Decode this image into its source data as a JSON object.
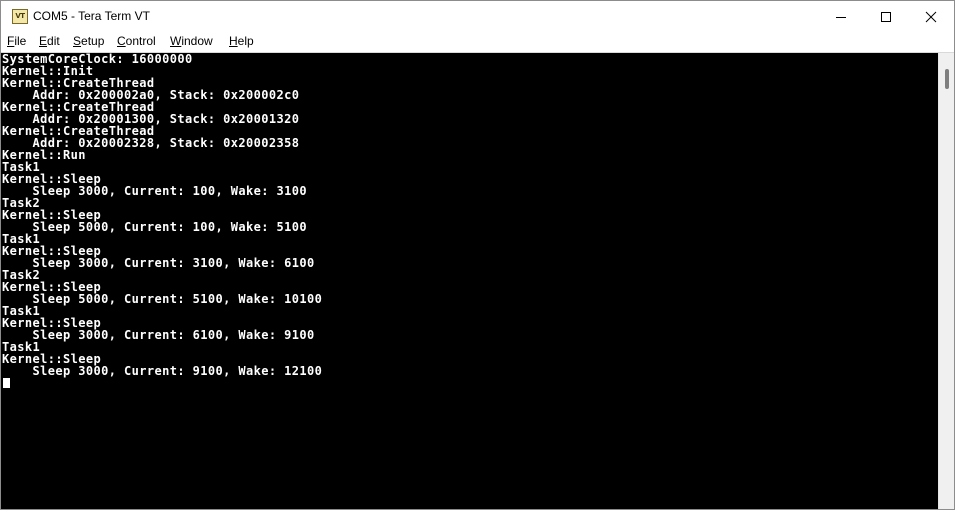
{
  "window": {
    "title": "COM5 - Tera Term VT",
    "icon_label": "VT"
  },
  "caption_buttons": {
    "minimize": "minimize-icon",
    "maximize": "maximize-icon",
    "close": "close-icon"
  },
  "menu": [
    {
      "accel": "F",
      "rest": "ile"
    },
    {
      "accel": "E",
      "rest": "dit"
    },
    {
      "accel": "S",
      "rest": "etup"
    },
    {
      "accel": "C",
      "rest": "ontrol"
    },
    {
      "accel": "W",
      "rest": "indow"
    },
    {
      "accel": "H",
      "rest": "elp"
    }
  ],
  "terminal": {
    "lines": [
      "SystemCoreClock: 16000000",
      "Kernel::Init",
      "Kernel::CreateThread",
      "    Addr: 0x200002a0, Stack: 0x200002c0",
      "Kernel::CreateThread",
      "    Addr: 0x20001300, Stack: 0x20001320",
      "Kernel::CreateThread",
      "    Addr: 0x20002328, Stack: 0x20002358",
      "Kernel::Run",
      "Task1",
      "Kernel::Sleep",
      "    Sleep 3000, Current: 100, Wake: 3100",
      "Task2",
      "Kernel::Sleep",
      "    Sleep 5000, Current: 100, Wake: 5100",
      "Task1",
      "Kernel::Sleep",
      "    Sleep 3000, Current: 3100, Wake: 6100",
      "Task2",
      "Kernel::Sleep",
      "    Sleep 5000, Current: 5100, Wake: 10100",
      "Task1",
      "Kernel::Sleep",
      "    Sleep 3000, Current: 6100, Wake: 9100",
      "Task1",
      "Kernel::Sleep",
      "    Sleep 3000, Current: 9100, Wake: 12100"
    ]
  },
  "colors": {
    "terminal_bg": "#000000",
    "terminal_fg": "#ffffff"
  }
}
